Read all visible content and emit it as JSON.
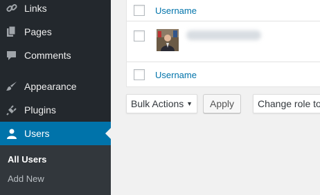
{
  "sidebar": {
    "items": [
      {
        "label": "Links",
        "icon": "link-icon"
      },
      {
        "label": "Pages",
        "icon": "pages-icon"
      },
      {
        "label": "Comments",
        "icon": "comments-icon"
      },
      {
        "label": "Appearance",
        "icon": "appearance-brush-icon"
      },
      {
        "label": "Plugins",
        "icon": "plugins-icon"
      },
      {
        "label": "Users",
        "icon": "users-icon",
        "active": true
      }
    ],
    "submenu": [
      {
        "label": "All Users",
        "current": true
      },
      {
        "label": "Add New"
      }
    ],
    "colors": {
      "background": "#23282d",
      "active": "#0073aa",
      "submenu": "#32373c"
    }
  },
  "table": {
    "header_column": "Username",
    "footer_column": "Username"
  },
  "bulk": {
    "action_select": "Bulk Actions",
    "apply_label": "Apply",
    "role_select": "Change role to…"
  }
}
